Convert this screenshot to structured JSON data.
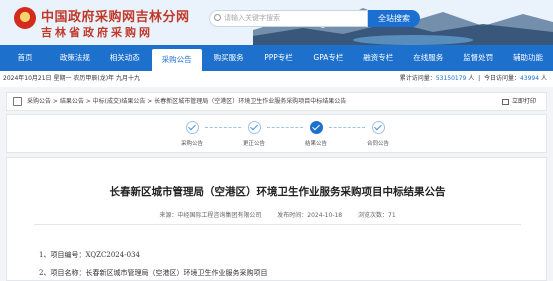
{
  "header": {
    "site_title": "中国政府采购网吉林分网",
    "site_subtitle": "吉林省政府采购网",
    "search_placeholder": "请输入关键字搜索",
    "search_button": "全站搜索"
  },
  "nav": {
    "items": [
      "首页",
      "政策法规",
      "相关动态",
      "采购公告",
      "购买服务",
      "PPP专栏",
      "GPA专栏",
      "融资专栏",
      "在线服务",
      "监督处罚",
      "辅助功能"
    ],
    "active_index": 3
  },
  "infobar": {
    "date": "2024年10月21日 星期一 农历甲辰(龙)年 九月十九",
    "total_label": "累计访问量：",
    "total_value": "53150179",
    "total_unit": "人",
    "today_label": "今日访问量：",
    "today_value": "43994",
    "today_unit": "人"
  },
  "breadcrumb": {
    "text": "采购公告 > 结果公告 > 中标(成交)结果公告 > 长春新区城市管理局（空港区）环境卫生作业服务采购项目中标结果公告",
    "print_label": "立即打印"
  },
  "steps": [
    {
      "label": "采购公告",
      "state": "done"
    },
    {
      "label": "更正公告",
      "state": "done"
    },
    {
      "label": "结果公告",
      "state": "current"
    },
    {
      "label": "合同公告",
      "state": "done"
    }
  ],
  "article": {
    "title": "长春新区城市管理局（空港区）环境卫生作业服务采购项目中标结果公告",
    "source": "来源：中经国际工程咨询集团有限公司",
    "publish_date": "发布时间：2024-10-18",
    "views": "浏览次数：71",
    "lines": [
      "1、项目编号：XQZC2024-034",
      "2、项目名称：长春新区城市管理局（空港区）环境卫生作业服务采购项目"
    ]
  },
  "colors": {
    "nav_blue": "#1d70cc",
    "brand_red": "#c0392b"
  }
}
